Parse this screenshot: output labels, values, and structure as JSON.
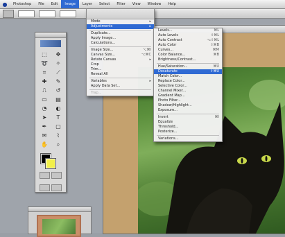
{
  "menubar": {
    "items": [
      {
        "label": "Photoshop",
        "active": false
      },
      {
        "label": "File",
        "active": false
      },
      {
        "label": "Edit",
        "active": false
      },
      {
        "label": "Image",
        "active": true
      },
      {
        "label": "Layer",
        "active": false
      },
      {
        "label": "Select",
        "active": false
      },
      {
        "label": "Filter",
        "active": false
      },
      {
        "label": "View",
        "active": false
      },
      {
        "label": "Window",
        "active": false
      },
      {
        "label": "Help",
        "active": false
      }
    ]
  },
  "image_menu": {
    "items": [
      {
        "label": "Mode",
        "shortcut": "▸",
        "highlight": false
      },
      {
        "label": "Adjustments",
        "shortcut": "▸",
        "highlight": true
      },
      {
        "sep": true
      },
      {
        "label": "Duplicate...",
        "shortcut": ""
      },
      {
        "label": "Apply Image...",
        "shortcut": ""
      },
      {
        "label": "Calculations...",
        "shortcut": ""
      },
      {
        "sep": true
      },
      {
        "label": "Image Size...",
        "shortcut": "⌥⌘I"
      },
      {
        "label": "Canvas Size...",
        "shortcut": "⌥⌘C"
      },
      {
        "label": "Rotate Canvas",
        "shortcut": "▸"
      },
      {
        "label": "Crop",
        "shortcut": ""
      },
      {
        "label": "Trim...",
        "shortcut": ""
      },
      {
        "label": "Reveal All",
        "shortcut": ""
      },
      {
        "sep": true
      },
      {
        "label": "Variables",
        "shortcut": "▸"
      },
      {
        "label": "Apply Data Set...",
        "shortcut": ""
      },
      {
        "sep": true
      },
      {
        "label": "Trap...",
        "shortcut": "",
        "dim": true
      }
    ]
  },
  "adjust_menu": {
    "items": [
      {
        "label": "Levels...",
        "shortcut": "⌘L"
      },
      {
        "label": "Auto Levels",
        "shortcut": "⇧⌘L"
      },
      {
        "label": "Auto Contrast",
        "shortcut": "⌥⇧⌘L"
      },
      {
        "label": "Auto Color",
        "shortcut": "⇧⌘B"
      },
      {
        "label": "Curves...",
        "shortcut": "⌘M"
      },
      {
        "label": "Color Balance...",
        "shortcut": "⌘B"
      },
      {
        "label": "Brightness/Contrast...",
        "shortcut": ""
      },
      {
        "sep": true
      },
      {
        "label": "Hue/Saturation...",
        "shortcut": "⌘U"
      },
      {
        "label": "Desaturate",
        "shortcut": "⇧⌘U",
        "highlight": true
      },
      {
        "label": "Match Color...",
        "shortcut": ""
      },
      {
        "label": "Replace Color...",
        "shortcut": ""
      },
      {
        "label": "Selective Color...",
        "shortcut": ""
      },
      {
        "label": "Channel Mixer...",
        "shortcut": ""
      },
      {
        "label": "Gradient Map...",
        "shortcut": ""
      },
      {
        "label": "Photo Filter...",
        "shortcut": ""
      },
      {
        "label": "Shadow/Highlight...",
        "shortcut": ""
      },
      {
        "label": "Exposure...",
        "shortcut": ""
      },
      {
        "sep": true
      },
      {
        "label": "Invert",
        "shortcut": "⌘I"
      },
      {
        "label": "Equalize",
        "shortcut": ""
      },
      {
        "label": "Threshold...",
        "shortcut": ""
      },
      {
        "label": "Posterize...",
        "shortcut": ""
      },
      {
        "sep": true
      },
      {
        "label": "Variations...",
        "shortcut": ""
      }
    ]
  },
  "tools": [
    {
      "icon": "marquee-icon",
      "glyph": "⬚"
    },
    {
      "icon": "move-icon",
      "glyph": "✥"
    },
    {
      "icon": "lasso-icon",
      "glyph": "➰"
    },
    {
      "icon": "magic-wand-icon",
      "glyph": "✧"
    },
    {
      "icon": "crop-icon",
      "glyph": "⌗"
    },
    {
      "icon": "slice-icon",
      "glyph": "⟋"
    },
    {
      "icon": "healing-brush-icon",
      "glyph": "✚"
    },
    {
      "icon": "brush-icon",
      "glyph": "✎"
    },
    {
      "icon": "stamp-icon",
      "glyph": "⎍"
    },
    {
      "icon": "history-brush-icon",
      "glyph": "↺"
    },
    {
      "icon": "eraser-icon",
      "glyph": "▭"
    },
    {
      "icon": "gradient-icon",
      "glyph": "▤"
    },
    {
      "icon": "blur-icon",
      "glyph": "◔"
    },
    {
      "icon": "dodge-icon",
      "glyph": "◐"
    },
    {
      "icon": "path-select-icon",
      "glyph": "➤"
    },
    {
      "icon": "type-icon",
      "glyph": "T"
    },
    {
      "icon": "pen-icon",
      "glyph": "✒"
    },
    {
      "icon": "shape-icon",
      "glyph": "▢"
    },
    {
      "icon": "notes-icon",
      "glyph": "✉"
    },
    {
      "icon": "eyedropper-icon",
      "glyph": "⌇"
    },
    {
      "icon": "hand-icon",
      "glyph": "✋"
    },
    {
      "icon": "zoom-icon",
      "glyph": "⌕"
    }
  ],
  "colors": {
    "foreground": "#000000",
    "background": "#f2f04a",
    "highlight": "#2f6ad3"
  }
}
